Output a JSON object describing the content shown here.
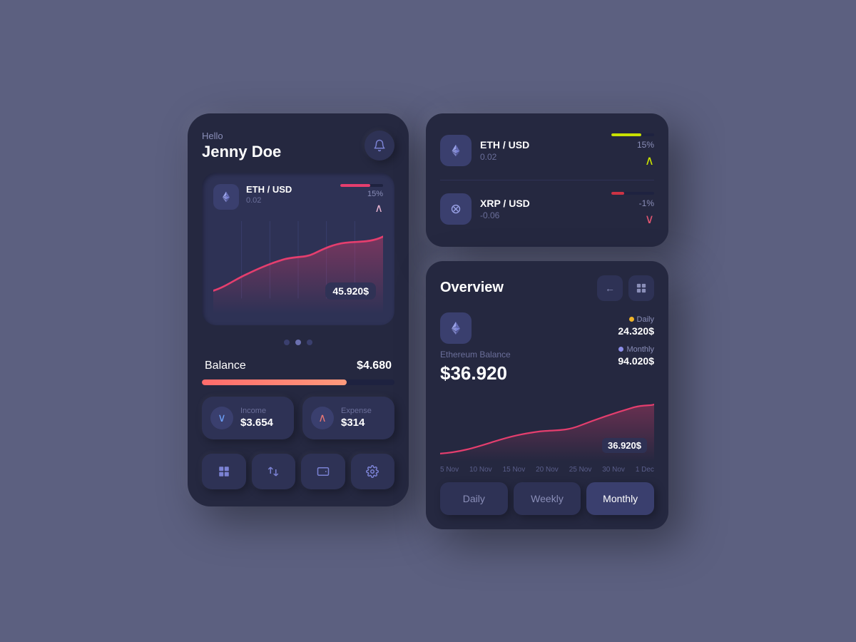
{
  "background": "#5c6080",
  "left_panel": {
    "hello_label": "Hello",
    "user_name": "Jenny Doe",
    "eth_pair": "ETH / USD",
    "eth_value": "0.02",
    "eth_percent": "15%",
    "chart_price": "45.920$",
    "balance_label": "Balance",
    "balance_amount": "$4.680",
    "income_label": "Income",
    "income_value": "$3.654",
    "expense_label": "Expense",
    "expense_value": "$314",
    "nav_items": [
      "dashboard",
      "swap",
      "wallet",
      "settings"
    ]
  },
  "crypto_cards": {
    "items": [
      {
        "pair": "ETH / USD",
        "value": "0.02",
        "percent": "15%",
        "trend": "up",
        "bar_color": "#c8e000",
        "bar_width": "70%"
      },
      {
        "pair": "XRP / USD",
        "value": "-0.06",
        "percent": "-1%",
        "trend": "down",
        "bar_color": "#cc3344",
        "bar_width": "30%"
      }
    ]
  },
  "overview": {
    "title": "Overview",
    "eth_balance_label": "Ethereum Balance",
    "eth_balance_value": "$36.920",
    "daily_label": "Daily",
    "daily_value": "24.320$",
    "monthly_label": "Monthly",
    "monthly_value": "94.020$",
    "chart_price": "36.920$",
    "x_labels": [
      "5 Nov",
      "10 Nov",
      "15 Nov",
      "20 Nov",
      "25 Nov",
      "30 Nov",
      "1 Dec"
    ],
    "tabs": [
      {
        "label": "Daily",
        "active": false
      },
      {
        "label": "Weekly",
        "active": false
      },
      {
        "label": "Monthly",
        "active": true
      }
    ],
    "daily_dot_color": "#f0b429",
    "monthly_dot_color": "#8b8de8"
  },
  "icons": {
    "bell": "🔔",
    "arrow_up": "∧",
    "arrow_down": "∨",
    "back": "←",
    "grid": "⊞"
  }
}
